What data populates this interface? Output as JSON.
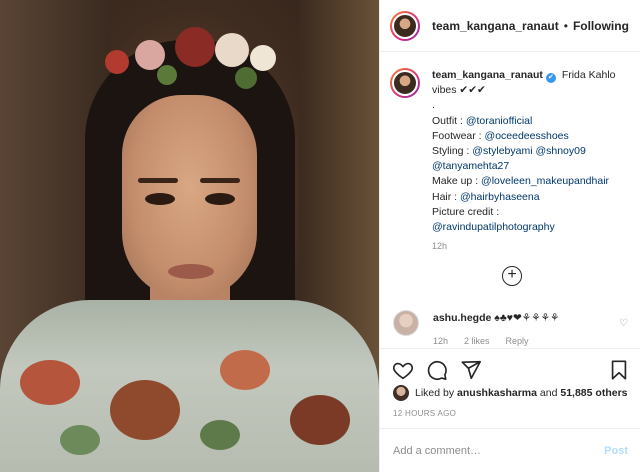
{
  "header": {
    "username": "team_kangana_ranaut",
    "separator": "•",
    "follow_label": "Following"
  },
  "caption": {
    "username": "team_kangana_ranaut",
    "verified_mark": "✔",
    "line1": "Frida Kahlo vibes ✔✔✔",
    "line2": ".",
    "outfit_label": "Outfit : ",
    "outfit_link": "@toraniofficial",
    "footwear_label": "Footwear : ",
    "footwear_link": "@oceedeesshoes",
    "styling_label": "Styling : ",
    "styling_link1": "@stylebyami",
    "styling_link2": "@shnoy09",
    "styling_link3": "@tanyamehta27",
    "makeup_label": "Make up : ",
    "makeup_link": "@loveleen_makeupandhair",
    "hair_label": "Hair : ",
    "hair_link": "@hairbyhaseena",
    "credit_label": "Picture credit :",
    "credit_link": "@ravindupatilphotography",
    "time": "12h"
  },
  "load_more_label": "+",
  "comment": {
    "username": "ashu.hegde",
    "text": "♠♣♥❤⚘⚘⚘⚘",
    "time": "12h",
    "likes": "2 likes",
    "reply": "Reply",
    "heart": "♡"
  },
  "likes": {
    "prefix": "Liked by ",
    "user": "anushkasharma",
    "middle": " and ",
    "count": "51,885 others"
  },
  "ago": "12 HOURS AGO",
  "add_comment": {
    "placeholder": "Add a comment…",
    "post_label": "Post"
  },
  "colors": {
    "link": "#00376b",
    "verified": "#3897f0",
    "post_disabled": "#b2dffc",
    "muted": "#8e8e8e"
  }
}
